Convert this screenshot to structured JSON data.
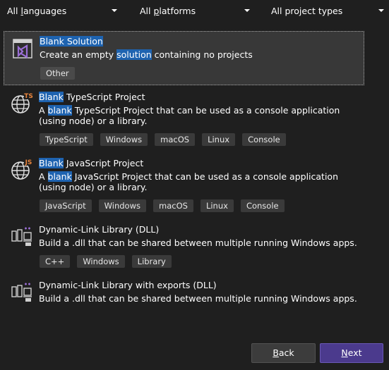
{
  "filters": {
    "language": {
      "prefix": "All ",
      "underlined": "l",
      "suffix": "anguages"
    },
    "platform": {
      "prefix": "All ",
      "underlined": "p",
      "suffix": "latforms"
    },
    "project_type": "All project types"
  },
  "templates": [
    {
      "title_hl": "Blank Solution",
      "title_rest": "",
      "desc_pre": "Create an empty ",
      "desc_hl": "solution",
      "desc_post": " containing no projects",
      "tags": [
        "Other"
      ],
      "icon": "visual-studio-solution-icon",
      "selected": true
    },
    {
      "title_hl": "Blank",
      "title_rest": " TypeScript Project",
      "desc_pre": "A ",
      "desc_hl": "blank",
      "desc_post": " TypeScript Project that can be used as a console application (using node) or a library.",
      "tags": [
        "TypeScript",
        "Windows",
        "macOS",
        "Linux",
        "Console"
      ],
      "icon": "typescript-globe-icon",
      "badge": "TS",
      "badge_color": "#e8843c"
    },
    {
      "title_hl": "Blank",
      "title_rest": " JavaScript Project",
      "desc_pre": "A ",
      "desc_hl": "blank",
      "desc_post": " JavaScript Project that can be used as a console application (using node) or a library.",
      "tags": [
        "JavaScript",
        "Windows",
        "macOS",
        "Linux",
        "Console"
      ],
      "icon": "javascript-globe-icon",
      "badge": "JS",
      "badge_color": "#e8843c"
    },
    {
      "title_hl": "",
      "title_rest": "Dynamic-Link Library (DLL)",
      "desc_pre": "Build a .dll that can be shared between multiple running Windows apps.",
      "desc_hl": "",
      "desc_post": "",
      "tags": [
        "C++",
        "Windows",
        "Library"
      ],
      "icon": "dll-library-icon"
    },
    {
      "title_hl": "",
      "title_rest": "Dynamic-Link Library with exports (DLL)",
      "desc_pre": "Build a .dll that can be shared between multiple running Windows apps.",
      "desc_hl": "",
      "desc_post": "",
      "tags": [],
      "icon": "dll-library-exports-icon"
    }
  ],
  "buttons": {
    "back": {
      "underlined": "B",
      "rest": "ack"
    },
    "next": {
      "underlined": "N",
      "rest": "ext"
    }
  },
  "colors": {
    "background": "#1f1f1f",
    "selected_background": "#383838",
    "highlight": "#1e63b0",
    "tag_background": "#3a3a3a",
    "next_button": "#4b3a8d",
    "vs_purple": "#9b6fd6"
  }
}
